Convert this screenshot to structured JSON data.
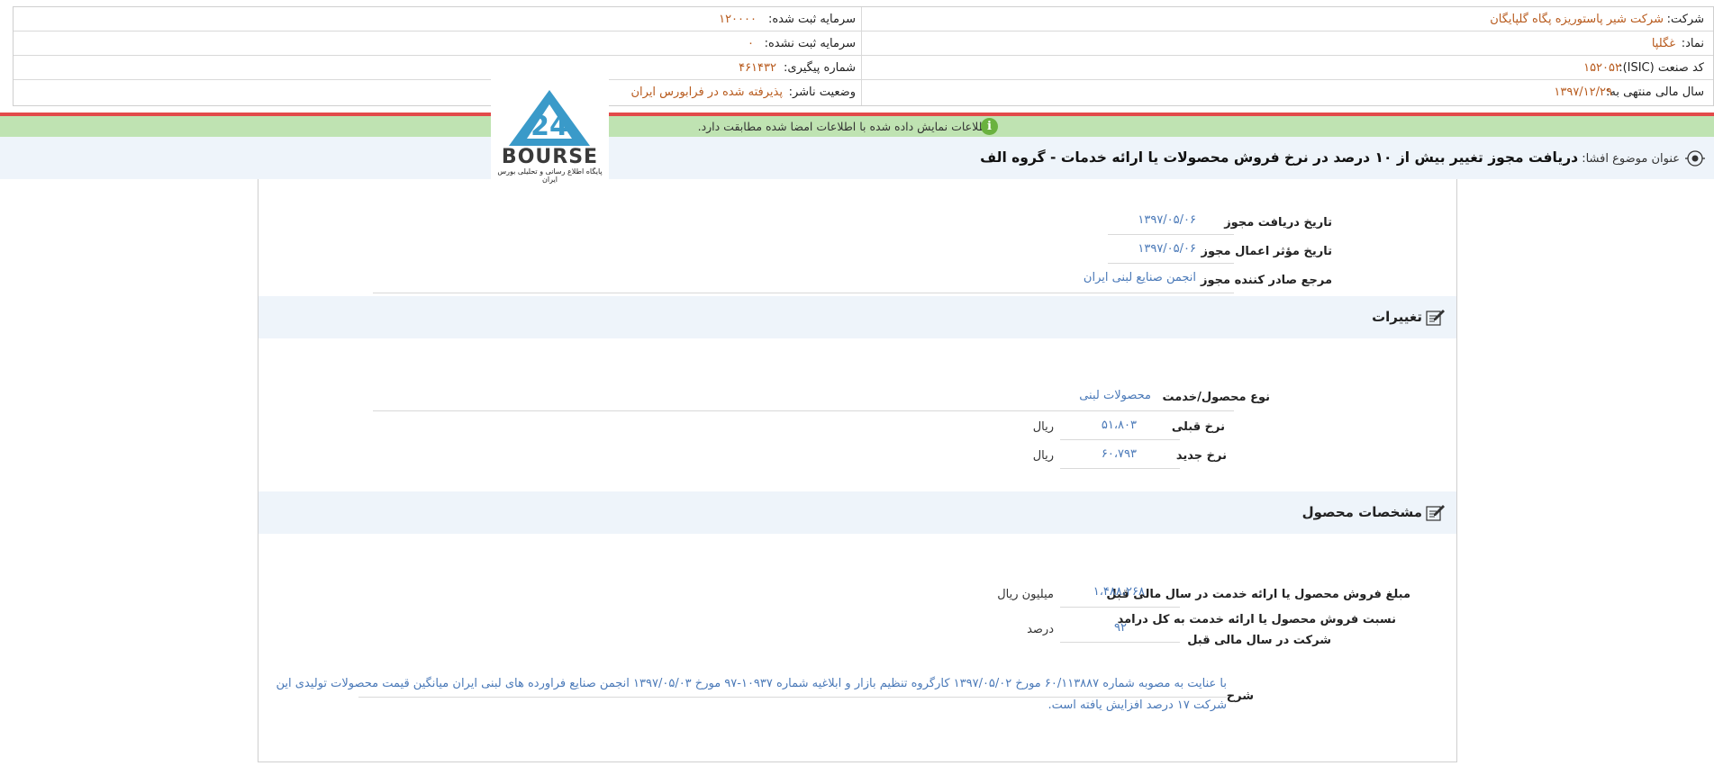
{
  "company_info": {
    "company_label": "شرکت:",
    "company_value": "شرکت شیر پاستوریزه پگاه گلپایگان",
    "symbol_label": "نماد:",
    "symbol_value": "غگلپا",
    "isic_label": "کد صنعت (ISIC):",
    "isic_value": "۱۵۲۰۵۲",
    "fiscal_year_label": "سال مالی منتهی به:",
    "fiscal_year_value": "۱۳۹۷/۱۲/۲۹",
    "registered_capital_label": "سرمایه ثبت شده:",
    "registered_capital_value": "۱۲۰۰۰۰",
    "unregistered_capital_label": "سرمایه ثبت نشده:",
    "unregistered_capital_value": "۰",
    "tracking_label": "شماره پیگیری:",
    "tracking_value": "۴۶۱۴۳۲",
    "publisher_status_label": "وضعیت ناشر:",
    "publisher_status_value": "پذیرفته شده در فرابورس ایران"
  },
  "status_bar": {
    "message": "اطلاعات نمایش داده شده با اطلاعات امضا شده مطابقت دارد.",
    "icon": "info-icon",
    "color": "#bfe3b2"
  },
  "subject": {
    "label": "عنوان موضوع افشا:",
    "title": "دریافت مجوز تغییر بیش از ۱۰ درصد در نرخ فروش محصولات یا ارائه خدمات - گروه الف",
    "icon": "target-icon"
  },
  "logo": {
    "word": "BOURSE",
    "subtitle": "پایگاه اطلاع رسانی و تحلیلی بورس ایران",
    "number": "24"
  },
  "permit": {
    "receipt_date_label": "تاریخ دریافت مجوز",
    "receipt_date_value": "۱۳۹۷/۰۵/۰۶",
    "effective_date_label": "تاریخ مؤثر اعمال مجوز",
    "effective_date_value": "۱۳۹۷/۰۵/۰۶",
    "issuer_label": "مرجع صادر کننده مجوز",
    "issuer_value": "انجمن صنایع لبنی ایران"
  },
  "changes": {
    "title": "تغییرات",
    "product_type_label": "نوع محصول/خدمت",
    "product_type_value": "محصولات لبنی",
    "prev_rate_label": "نرخ قبلی",
    "prev_rate_value": "۵۱،۸۰۳",
    "prev_rate_unit": "ریال",
    "new_rate_label": "نرخ جدید",
    "new_rate_value": "۶۰،۷۹۳",
    "new_rate_unit": "ریال"
  },
  "product_specs": {
    "title": "مشخصات محصول",
    "sales_label": "مبلغ فروش محصول یا ارائه خدمت در سال مالی قبل",
    "sales_value": "۱،۴۸۸،۲۶۸",
    "sales_unit": "میلیون ریال",
    "ratio_label_1": "نسبت فروش محصول یا ارائه خدمت به کل درامد",
    "ratio_label_2": "شرکت در سال مالی قبل",
    "ratio_value": "۹۲",
    "ratio_unit": "درصد",
    "description_label": "شرح",
    "description_line_1": "با عنایت به مصوبه شماره ۶۰/۱۱۳۸۸۷ مورخ ۱۳۹۷/۰۵/۰۲ کارگروه تنظیم بازار و ابلاغیه شماره ۱۰۹۳۷-۹۷ مورخ ۱۳۹۷/۰۵/۰۳ انجمن صنایع فراورده های لبنی ایران میانگین قیمت محصولات تولیدی این",
    "description_line_2": "شرکت ۱۷ درصد افزایش یافته است."
  },
  "colors": {
    "accent_value": "#b85b1e",
    "link_value": "#4a79b8",
    "red_line": "#e24a4a",
    "section_band": "#eef4fa"
  }
}
